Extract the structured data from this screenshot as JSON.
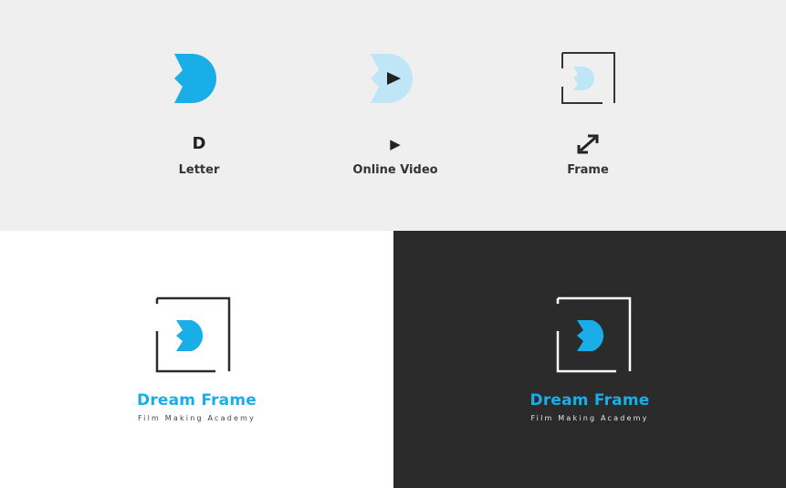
{
  "concepts": [
    {
      "symbol": "D",
      "label": "Letter",
      "icon": "d-letter-icon"
    },
    {
      "symbol": "▶",
      "label": "Online Video",
      "icon": "play-icon"
    },
    {
      "symbol": "",
      "label": "Frame",
      "icon": "frame-corners-icon"
    }
  ],
  "logo_light": {
    "name": "Dream Frame",
    "tagline": "Film Making Academy"
  },
  "logo_dark": {
    "name": "Dream Frame",
    "tagline": "Film Making Academy"
  },
  "colors": {
    "brand_blue": "#1aaee8",
    "light_blue": "#bfe6f7",
    "dark_bg": "#2b2b2b",
    "light_bg": "#efefef",
    "white_bg": "#ffffff"
  }
}
